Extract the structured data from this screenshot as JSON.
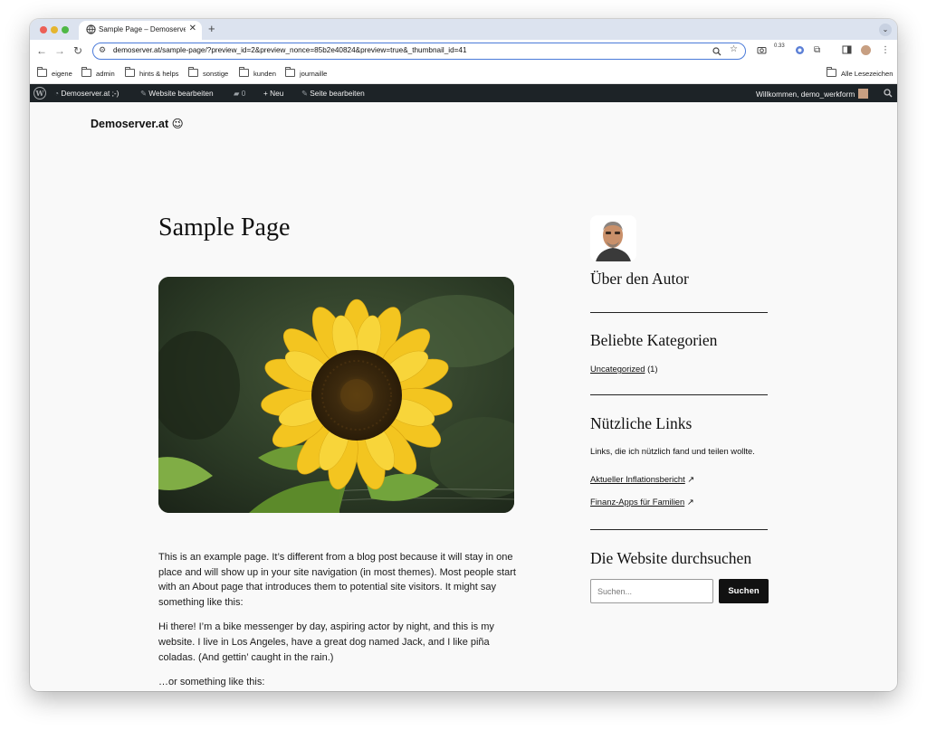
{
  "browser": {
    "tab_title": "Sample Page – Demoserver.at",
    "tab_close": "✕",
    "new_tab": "+",
    "tab_menu": "⌄",
    "url": "demoserver.at/sample-page/?preview_id=2&preview_nonce=85b2e40824&preview=true&_thumbnail_id=41",
    "extension_badge": "0.33",
    "bookmarks": [
      "eigene",
      "admin",
      "hints & helps",
      "sonstige",
      "kunden",
      "journaille"
    ],
    "all_bookmarks": "Alle Lesezeichen"
  },
  "adminbar": {
    "wp_logo": "W",
    "site_name": "Demoserver.at ;-)",
    "customize": "Website bearbeiten",
    "comments_count": "0",
    "new_label": "Neu",
    "edit_page": "Seite bearbeiten",
    "welcome": "Willkommen, demo_werkform"
  },
  "site": {
    "title": "Demoserver.at 😉"
  },
  "main": {
    "page_title": "Sample Page",
    "paragraphs": [
      "This is an example page. It’s different from a blog post because it will stay in one place and will show up in your site navigation (in most themes). Most people start with an About page that introduces them to potential site visitors. It might say something like this:",
      "Hi there! I’m a bike messenger by day, aspiring actor by night, and this is my website. I live in Los Angeles, have a great dog named Jack, and I like piña coladas. (And gettin’ caught in the rain.)",
      "…or something like this:"
    ]
  },
  "sidebar": {
    "about_heading": "Über den Autor",
    "categories_heading": "Beliebte Kategorien",
    "category_name": "Uncategorized",
    "category_count": "(1)",
    "links_heading": "Nützliche Links",
    "links_description": "Links, die ich nützlich fand und teilen wollte.",
    "links": [
      "Aktueller Inflationsbericht",
      "Finanz-Apps für Familien"
    ],
    "external_arrow": "↗",
    "search_heading": "Die Website durchsuchen",
    "search_placeholder": "Suchen...",
    "search_button": "Suchen"
  },
  "colors": {
    "adminbar_bg": "#1d2327",
    "page_bg": "#f9f9f9",
    "omnibox_border": "#4a7ad9",
    "search_button_bg": "#111111"
  }
}
